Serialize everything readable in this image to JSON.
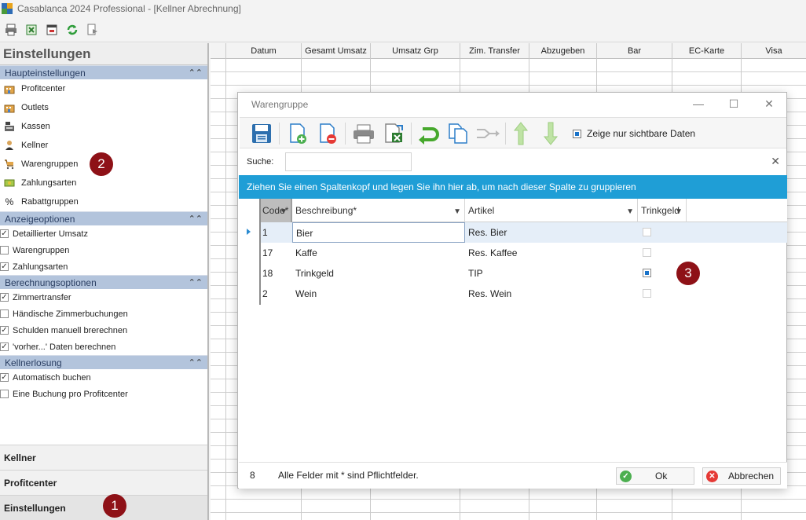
{
  "window": {
    "title": "Casablanca 2024 Professional - [Kellner Abrechnung]"
  },
  "toolbar": {
    "icons": [
      "printer-icon",
      "export-excel-icon",
      "window-icon",
      "refresh-icon",
      "preview-icon"
    ]
  },
  "left_panel": {
    "header": "Einstellungen",
    "groups": [
      {
        "title": "Haupteinstellungen",
        "items": [
          "Profitcenter",
          "Outlets",
          "Kassen",
          "Kellner",
          "Warengruppen",
          "Zahlungsarten",
          "Rabattgruppen"
        ]
      },
      {
        "title": "Anzeigeoptionen",
        "options": [
          {
            "label": "Detaillierter Umsatz",
            "checked": true
          },
          {
            "label": "Warengruppen",
            "checked": false
          },
          {
            "label": "Zahlungsarten",
            "checked": true
          }
        ]
      },
      {
        "title": "Berechnungsoptionen",
        "options": [
          {
            "label": "Zimmertransfer",
            "checked": true
          },
          {
            "label": "Händische Zimmerbuchungen",
            "checked": false
          },
          {
            "label": "Schulden manuell brerechnen",
            "checked": true
          },
          {
            "label": "'vorher...' Daten berechnen",
            "checked": true
          }
        ]
      },
      {
        "title": "Kellnerlosung",
        "options": [
          {
            "label": "Automatisch buchen",
            "checked": true
          },
          {
            "label": "Eine Buchung pro Profitcenter",
            "checked": false
          }
        ]
      }
    ],
    "bottom_tabs": [
      "Kellner",
      "Profitcenter",
      "Einstellungen"
    ]
  },
  "grid": {
    "columns": [
      "Datum",
      "Gesamt Umsatz",
      "Umsatz Grp",
      "Zim. Transfer",
      "Abzugeben",
      "Bar",
      "EC-Karte",
      "Visa"
    ]
  },
  "dialog": {
    "title": "Warengruppe",
    "show_visible_only": "Zeige nur sichtbare Daten",
    "search_label": "Suche:",
    "search_value": "",
    "group_hint": "Ziehen Sie einen Spaltenkopf und legen Sie ihn hier ab, um nach dieser Spalte zu gruppieren",
    "columns": [
      "Code*",
      "Beschreibung*",
      "Artikel",
      "Trinkgeld"
    ],
    "rows": [
      {
        "code": "1",
        "beschreibung": "Bier",
        "artikel": "Res. Bier",
        "trinkgeld": false
      },
      {
        "code": "17",
        "beschreibung": "Kaffe",
        "artikel": "Res. Kaffee",
        "trinkgeld": false
      },
      {
        "code": "18",
        "beschreibung": "Trinkgeld",
        "artikel": "TIP",
        "trinkgeld": true
      },
      {
        "code": "2",
        "beschreibung": "Wein",
        "artikel": "Res. Wein",
        "trinkgeld": false
      }
    ],
    "footer": {
      "count": "8",
      "required_note": "Alle Felder mit * sind Pflichtfelder.",
      "ok": "Ok",
      "cancel": "Abbrechen"
    }
  },
  "callouts": [
    "1",
    "2",
    "3"
  ],
  "colors": {
    "group_bar": "#1f9ed6",
    "panel_group": "#b3c4dc",
    "callout": "#8e1117"
  }
}
